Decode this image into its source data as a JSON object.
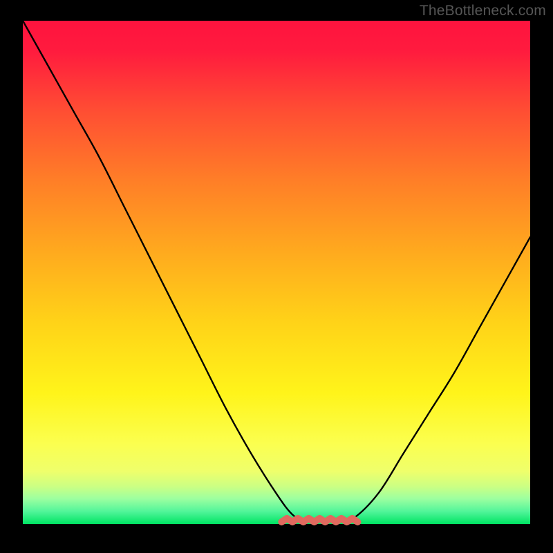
{
  "credit": "TheBottleneck.com",
  "chart_data": {
    "type": "line",
    "title": "",
    "xlabel": "",
    "ylabel": "",
    "xlim": [
      0,
      100
    ],
    "ylim": [
      0,
      100
    ],
    "grid": false,
    "legend": false,
    "x": [
      0,
      5,
      10,
      15,
      20,
      25,
      30,
      35,
      40,
      45,
      50,
      53,
      55,
      58,
      60,
      62,
      65,
      70,
      75,
      80,
      85,
      90,
      95,
      100
    ],
    "values": [
      100,
      91,
      82,
      73,
      63,
      53,
      43,
      33,
      23,
      14,
      6,
      2,
      1,
      0.5,
      0.5,
      0.5,
      1,
      6,
      14,
      22,
      30,
      39,
      48,
      57
    ],
    "colors": {
      "bg_top": "#ff163f",
      "bg_mid_upper": "#ff8d1f",
      "bg_mid": "#ffe61a",
      "bg_lower1": "#fbff57",
      "bg_lower2": "#ddff7a",
      "bg_lower3": "#8fff9a",
      "bg_bottom": "#00e463",
      "frame": "#000000",
      "curve": "#000000",
      "bottom_highlight": "#e06a5f"
    }
  }
}
